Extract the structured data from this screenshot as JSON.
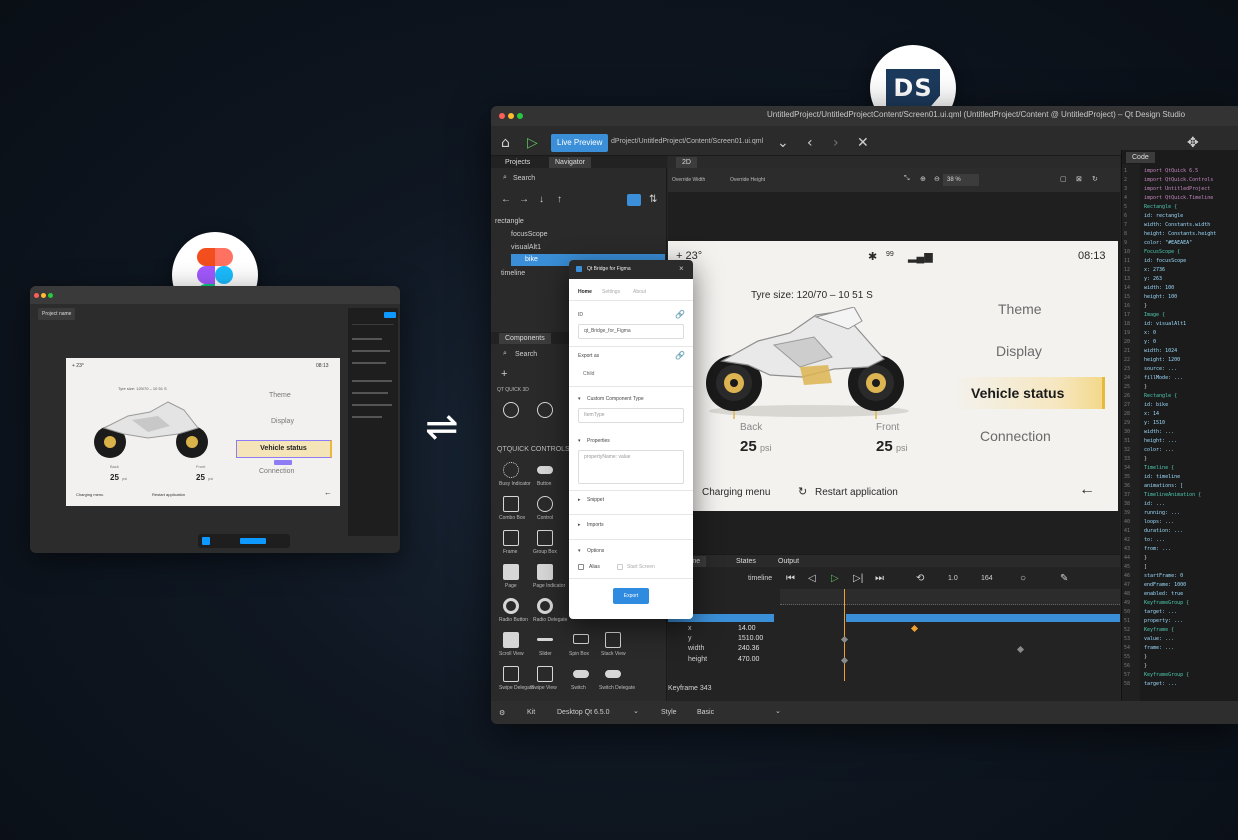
{
  "figma": {
    "file_label": "Project name",
    "canvas": {
      "status_temp": "+ 23°",
      "time": "08:13",
      "tyre_size": "Tyre size: 120/70 – 10 51 S",
      "menu": [
        "Theme",
        "Display",
        "Vehicle status",
        "Connection"
      ],
      "back_label": "Back",
      "front_label": "Front",
      "back_value": "25",
      "front_value": "25",
      "unit": "psi",
      "charging_menu": "Charging menu",
      "restart": "Restart application"
    }
  },
  "ds_badge": "DS",
  "qtds": {
    "window_title": "UntitledProject/UntitledProjectContent/Screen01.ui.qml (UntitledProject/Content @ UntitledProject) – Qt Design Studio",
    "live_preview": "Live Preview",
    "breadcrumb": "dProject/UntitledProject/Content/Screen01.ui.qml",
    "left_tabs": [
      "Projects",
      "Navigator"
    ],
    "search_label": "Search",
    "navigator_items": [
      "rectangle",
      "focusScope",
      "visualAlt1",
      "bike",
      "timeline"
    ],
    "components_tab": "Components",
    "components_search": "Search",
    "section_qtquick3d": "QT QUICK 3D",
    "section_controls": "QTQUICK CONTROLS",
    "component_labels": [
      "Busy Indicator",
      "Button",
      "Combo Box",
      "Control",
      "Frame",
      "Group Box",
      "Page",
      "Page Indicator",
      "Radio Button",
      "Radio Delegate",
      "Scroll View",
      "Slider",
      "Spin Box",
      "Stack View",
      "Swipe Delegate",
      "Swipe View",
      "Switch",
      "Switch Delegate"
    ],
    "center_tab": "2D",
    "override_width": "Override Width",
    "override_height": "Override Height",
    "zoom": "38 %",
    "canvas": {
      "status_temp": "+ 23°",
      "signal": "99",
      "time": "08:13",
      "tyre_size": "Tyre size: 120/70 – 10 51 S",
      "menu": [
        "Theme",
        "Display",
        "Vehicle status",
        "Connection"
      ],
      "back_label": "Back",
      "front_label": "Front",
      "back_value": "25",
      "front_value": "25",
      "unit": "psi",
      "charging_menu": "Charging menu",
      "restart": "Restart application",
      "back_arrow": "←"
    },
    "timeline_tabs": [
      "Timeline",
      "States",
      "Output"
    ],
    "timeline_label": "timeline",
    "timeline_controls": {
      "speed": "1.0",
      "frame": "164"
    },
    "tl_rows": [
      {
        "label": "x",
        "value": "14.00"
      },
      {
        "label": "y",
        "value": "1510.00"
      },
      {
        "label": "width",
        "value": "240.36"
      },
      {
        "label": "height",
        "value": "470.00"
      }
    ],
    "keyframe_label": "Keyframe 343",
    "code_tab": "Code",
    "code_lines": [
      "import QtQuick 6.5",
      "import QtQuick.Controls",
      "import UntitledProject",
      "import QtQuick.Timeline",
      "Rectangle {",
      "  id: rectangle",
      "  width: Constants.width",
      "  height: Constants.height",
      "  color: \"#EAEAEA\"",
      "  FocusScope {",
      "    id: focusScope",
      "    x: 2736",
      "    y: 263",
      "    width: 100",
      "    height: 100",
      "  }",
      "  Image {",
      "    id: visualAlt1",
      "    x: 0",
      "    y: 0",
      "    width: 1024",
      "    height: 1200",
      "    source: ...",
      "    fillMode: ...",
      "  }",
      "  Rectangle {",
      "    id: bike",
      "    x: 14",
      "    y: 1510",
      "    width: ...",
      "    height: ...",
      "    color: ...",
      "  }",
      "  Timeline {",
      "    id: timeline",
      "    animations: [",
      "      TimelineAnimation {",
      "        id: ...",
      "        running: ...",
      "        loops: ...",
      "        duration: ...",
      "        to: ...",
      "        from: ...",
      "      }",
      "    ]",
      "    startFrame: 0",
      "    endFrame: 1000",
      "    enabled: true",
      "    KeyframeGroup {",
      "      target: ...",
      "      property: ...",
      "      Keyframe {",
      "        value: ...",
      "        frame: ...",
      "      }",
      "    }",
      "    KeyframeGroup {",
      "      target: ..."
    ],
    "status_kit": "Kit",
    "status_kit_value": "Desktop Qt 6.5.0",
    "status_style": "Style",
    "status_style_value": "Basic"
  },
  "bridge_dialog": {
    "title": "Qt Bridge for Figma",
    "tabs": [
      "Home",
      "Settings",
      "About"
    ],
    "id_label": "ID",
    "id_value": "qt_Bridge_for_Figma",
    "export_as_label": "Export as",
    "export_as_value": "Child",
    "custom_type_label": "Custom Component Type",
    "custom_type_placeholder": "ItemType",
    "properties_label": "Properties",
    "properties_placeholder": "propertyName: value",
    "sections": [
      "Snippet",
      "Imports",
      "Options"
    ],
    "alias_label": "Alias",
    "start_screen_label": "Start Screen",
    "export_button": "Export"
  },
  "colors": {
    "qt_accent": "#3a8fd8",
    "vehicle_highlight": "#e8b93a",
    "timeline_marker": "#f0a030"
  }
}
